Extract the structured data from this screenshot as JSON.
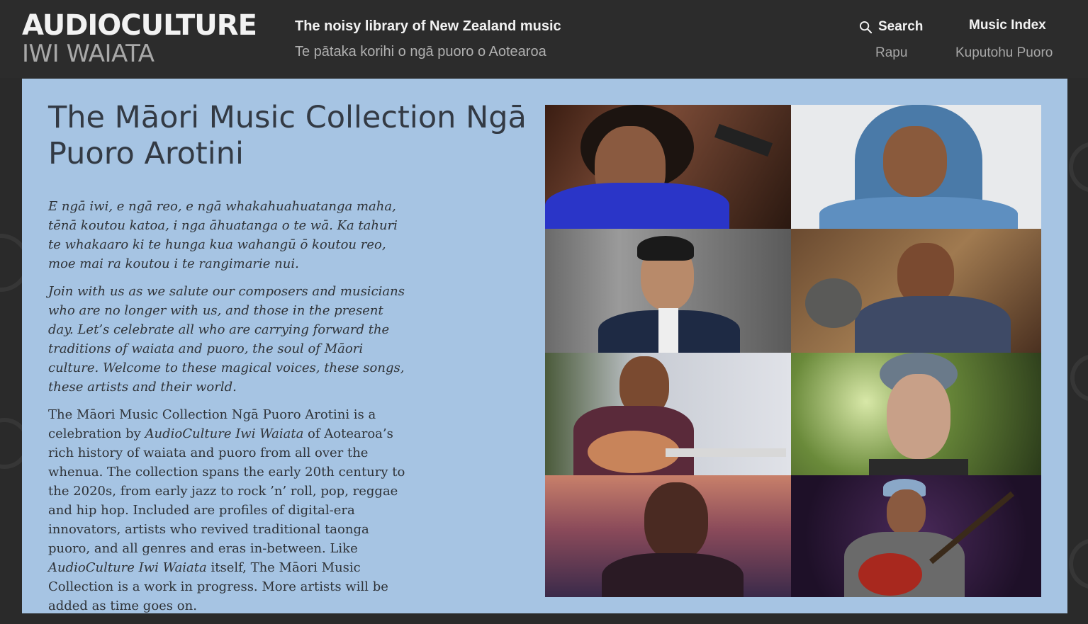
{
  "header": {
    "logo_line1": "AUDIOCULTURE",
    "logo_line2": "IWI WAIATA",
    "tagline_en": "The noisy library of New Zealand music",
    "tagline_mi": "Te pātaka korihi o ngā puoro o Aotearoa",
    "nav": {
      "search_label": "Search",
      "search_sub": "Rapu",
      "index_label": "Music Index",
      "index_sub": "Kuputohu Puoro"
    }
  },
  "main": {
    "title": "The Māori Music Collection Ngā Puoro Arotini",
    "intro_1": "E ngā iwi, e ngā reo, e ngā whakahuahuatanga maha, tēnā koutou katoa, i nga āhuatanga o te wā. Ka tahuri te whakaaro ki te hunga kua wahangū ō koutou reo, moe mai ra koutou i te rangimarie nui.",
    "intro_2": "Join with us as we salute our composers and musicians who are no longer with us, and those in the present day. Let’s celebrate all who are carrying forward the traditions of waiata and puoro, the soul of Māori culture. Welcome to these magical voices, these songs, these artists and their world.",
    "body_a": "The Māori Music Collection Ngā Puoro Arotini is a celebration by ",
    "body_em1": "AudioCulture Iwi Waiata",
    "body_b": " of Aotearoa’s rich history of waiata and puoro from all over the whenua. The collection spans the early 20th century to the 2020s, from early jazz to rock ’n’ roll, pop, reggae and hip hop. Included are profiles of digital-era innovators, artists who revived traditional taonga puoro, and all genres and eras in-between. Like ",
    "body_em2": "AudioCulture Iwi Waiata",
    "body_c": " itself, The Māori Music Collection is a work in progress. More artists will be added as time goes on."
  },
  "colors": {
    "header_bg": "#2c2c2c",
    "panel_bg": "#a6c4e3",
    "title_color": "#333a44"
  }
}
